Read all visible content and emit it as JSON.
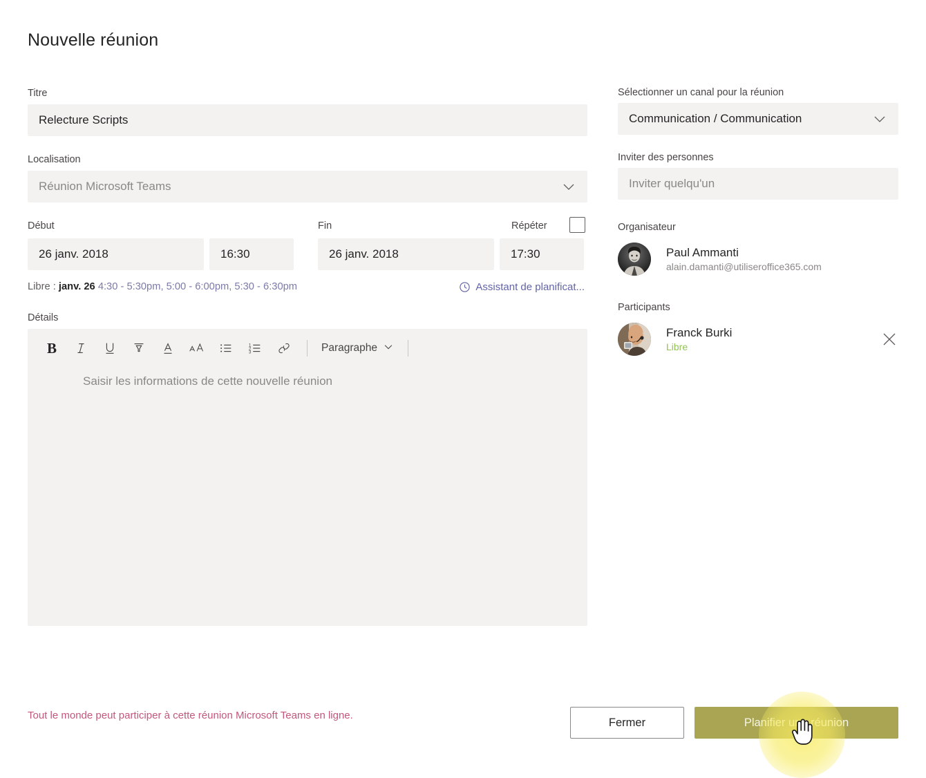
{
  "dialog": {
    "title": "Nouvelle réunion"
  },
  "form": {
    "title_label": "Titre",
    "title_value": "Relecture Scripts",
    "location_label": "Localisation",
    "location_value": "Réunion Microsoft Teams",
    "start_label": "Début",
    "start_date": "26 janv. 2018",
    "start_time": "16:30",
    "end_label": "Fin",
    "end_date": "26 janv. 2018",
    "end_time": "17:30",
    "repeat_label": "Répéter",
    "repeat_checked": false,
    "free_label": "Libre :",
    "free_day": "janv. 26",
    "free_slots": "4:30 - 5:30pm,  5:00 - 6:00pm,  5:30 - 6:30pm",
    "scheduling_assistant": "Assistant de planificat...",
    "details_label": "Détails",
    "details_placeholder": "Saisir les informations de cette nouvelle réunion"
  },
  "editor_toolbar": {
    "bold": "B",
    "paragraph_label": "Paragraphe",
    "buttons": [
      {
        "name": "bold",
        "glyph": "B"
      },
      {
        "name": "italic",
        "glyph": "I"
      },
      {
        "name": "underline",
        "glyph": "U"
      },
      {
        "name": "highlight",
        "glyph": "highlighter"
      },
      {
        "name": "font-color",
        "glyph": "A"
      },
      {
        "name": "font-size",
        "glyph": "AA"
      },
      {
        "name": "bulleted-list",
        "glyph": "list"
      },
      {
        "name": "numbered-list",
        "glyph": "ordered-list"
      },
      {
        "name": "link",
        "glyph": "link"
      }
    ]
  },
  "right": {
    "channel_label": "Sélectionner un canal pour la réunion",
    "channel_value": "Communication / Communication",
    "invite_label": "Inviter des personnes",
    "invite_placeholder": "Inviter quelqu'un",
    "organizer_label": "Organisateur",
    "organizer_name": "Paul Ammanti",
    "organizer_email": "alain.damanti@utiliseroffice365.com",
    "attendees_label": "Participants",
    "attendees": [
      {
        "name": "Franck Burki",
        "status": "Libre"
      }
    ]
  },
  "footer": {
    "note": "Tout le monde peut participer à cette réunion Microsoft Teams en ligne.",
    "close_button": "Fermer",
    "schedule_button": "Planifier une réunion"
  },
  "colors": {
    "field_background": "#f3f2f1",
    "accent_purple": "#6264a7",
    "free_green": "#92c353",
    "note_red": "#c4577a",
    "primary_button": "#a9a552",
    "click_highlight": "#f7eb60"
  }
}
